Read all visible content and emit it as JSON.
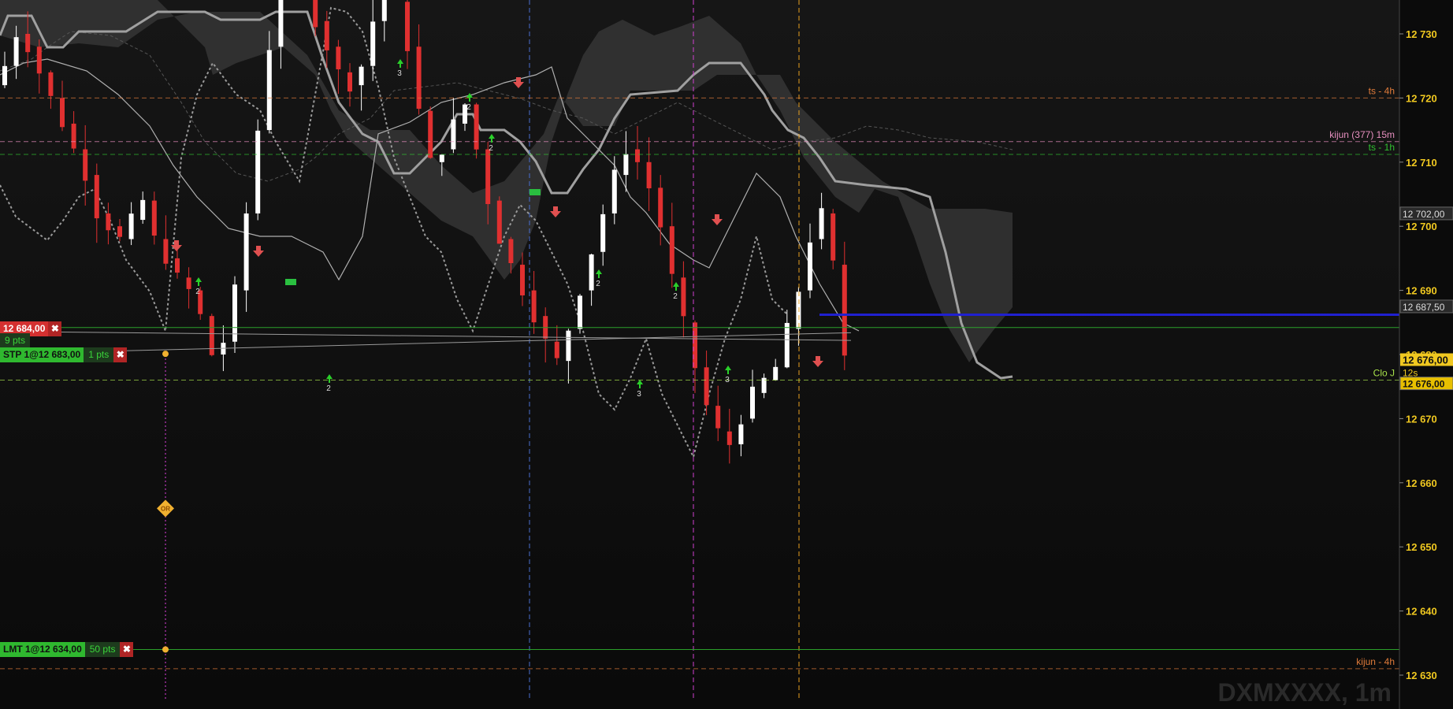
{
  "chart_data": {
    "type": "candlestick",
    "instrument": "DXMXXXX, 1m",
    "y_axis": {
      "ticks": [
        "12 730",
        "12 720",
        "12 710",
        "12 700",
        "12 690",
        "12 680",
        "12 670",
        "12 660",
        "12 650",
        "12 640",
        "12 630"
      ],
      "ylim": [
        12628,
        12734
      ],
      "current_price": "12 676,00",
      "countdown": "12s",
      "flags": [
        {
          "text": "12 702,00",
          "price": 12702
        },
        {
          "text": "12 687,50",
          "price": 12687.5
        },
        {
          "text": "12 676,00",
          "price": 12675.5
        }
      ]
    },
    "levels": [
      {
        "label": "ts - 4h",
        "price": 12720,
        "color": "#e07b3a",
        "style": "dashed"
      },
      {
        "label": "kijun (377) 15m",
        "price": 12713.2,
        "color": "#e890c0",
        "style": "dashed"
      },
      {
        "label": "ts - 1h",
        "price": 12711.2,
        "color": "#30c030",
        "style": "dashed"
      },
      {
        "label": "Clo J",
        "price": 12676,
        "color": "#a6e04a",
        "style": "dashed"
      },
      {
        "label": "kijun - 4h",
        "price": 12631,
        "color": "#e07b3a",
        "style": "dashed"
      }
    ],
    "orders": [
      {
        "label": "12 684,00",
        "pts": "",
        "kind": "close",
        "price": 12684
      },
      {
        "label": "9 pts",
        "pts": "",
        "kind": "position",
        "price": 12682.2
      },
      {
        "label": "STP 1@12 683,00",
        "pts": "1 pts",
        "kind": "stop",
        "price": 12680
      },
      {
        "label": "LMT 1@12 634,00",
        "pts": "50 pts",
        "kind": "limit",
        "price": 12634
      }
    ],
    "marker": {
      "text": "OR",
      "price": 12656
    }
  },
  "colors": {
    "up": "#ffffff",
    "down": "#e03030",
    "cloud": "#3a3a3a",
    "tenkan": "#b0b0b0",
    "kijun": "#a0a0a0",
    "chikou": "#9a9a9a",
    "blue_level": "#2020d0"
  },
  "icons": {
    "close": "close-icon",
    "signal_up": "arrow-up-icon",
    "signal_down": "arrow-down-icon"
  }
}
